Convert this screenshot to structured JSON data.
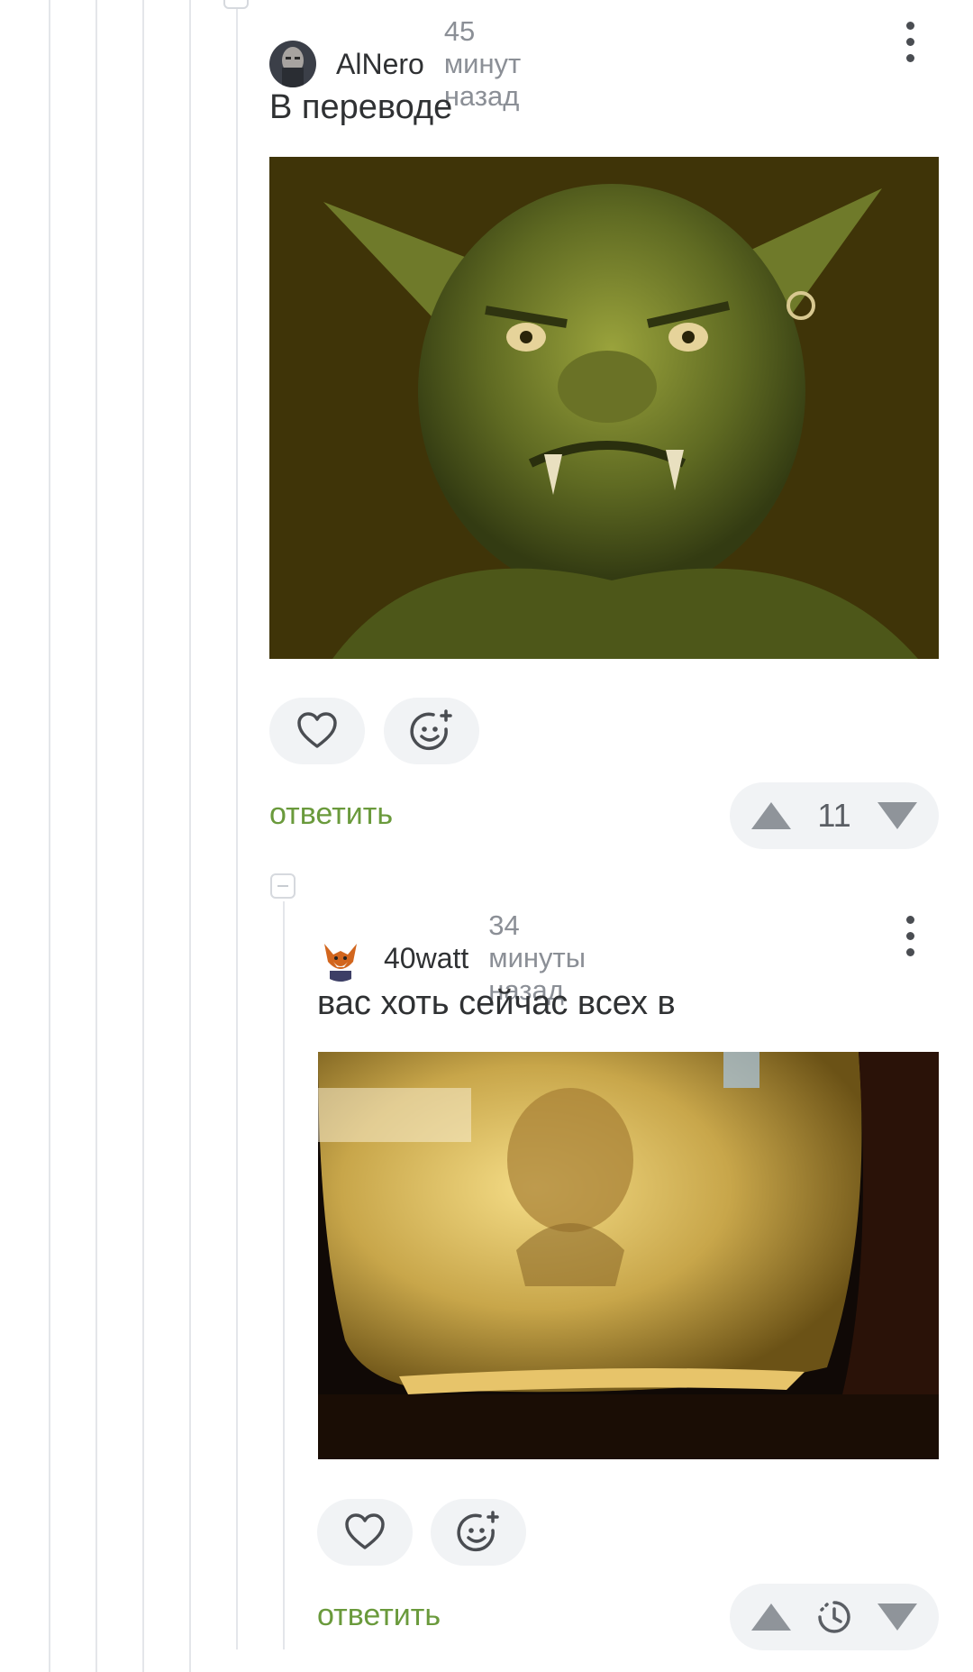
{
  "comments": [
    {
      "username": "AlNero",
      "time": "45 минут назад",
      "text": "В переводе",
      "reply_label": "ответить",
      "score": "11"
    },
    {
      "username": "40watt",
      "time": "34 минуты назад",
      "text": "вас хоть сейчас всех в",
      "reply_label": "ответить",
      "score": ""
    }
  ],
  "icons": {
    "like": "heart-icon",
    "react": "smiley-plus-icon",
    "upvote": "triangle-up-icon",
    "downvote": "triangle-down-icon",
    "pending": "clock-icon",
    "more": "kebab-menu-icon"
  }
}
